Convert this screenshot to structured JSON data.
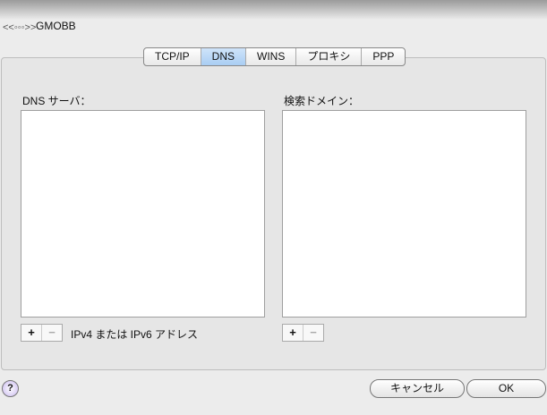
{
  "header": {
    "title": "GMOBB",
    "icon": "network-service-icon"
  },
  "tabs": [
    {
      "label": "TCP/IP"
    },
    {
      "label": "DNS",
      "selected": true
    },
    {
      "label": "WINS"
    },
    {
      "label": "プロキシ"
    },
    {
      "label": "PPP"
    }
  ],
  "dns": {
    "servers_label": "DNS サーバ：",
    "servers": [],
    "hint": "IPv4 または IPv6 アドレス"
  },
  "search": {
    "label": "検索ドメイン：",
    "domains": []
  },
  "buttons": {
    "add": "+",
    "remove": "−",
    "cancel": "キャンセル",
    "ok": "OK",
    "help": "?"
  }
}
